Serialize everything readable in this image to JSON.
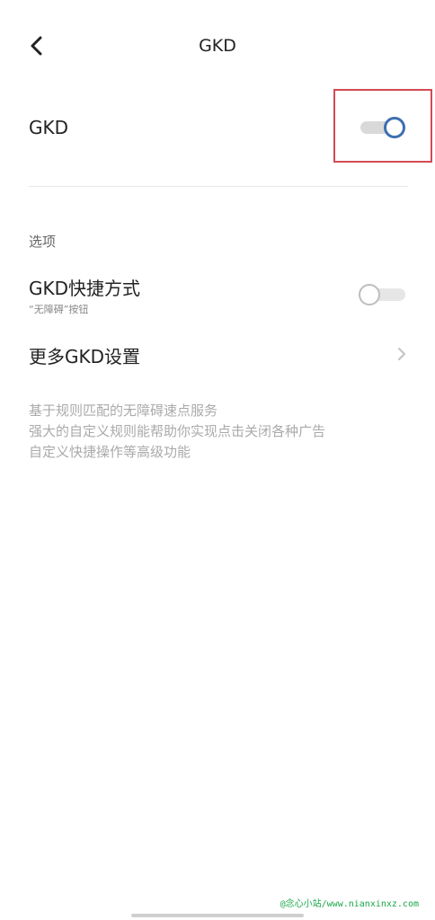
{
  "header": {
    "title": "GKD"
  },
  "main_toggle": {
    "label": "GKD",
    "on": true
  },
  "section": {
    "title": "选项"
  },
  "shortcut": {
    "label": "GKD快捷方式",
    "sublabel": "“无障碍”按钮",
    "on": false
  },
  "more": {
    "label": "更多GKD设置"
  },
  "description": [
    "基于规则匹配的无障碍速点服务",
    "强大的自定义规则能帮助你实现点击关闭各种广告",
    "自定义快捷操作等高级功能"
  ],
  "watermark": "@念心小站/www.nianxinxz.com",
  "colors": {
    "accent": "#3c6fb0",
    "highlight": "#d24a55",
    "watermark": "#1aa84a"
  },
  "icons": {
    "back": "back-arrow-icon",
    "more": "chevron-right-icon"
  }
}
